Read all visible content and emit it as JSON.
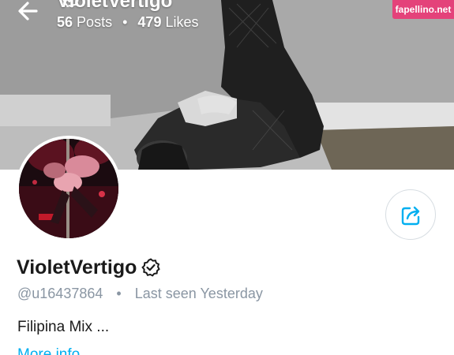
{
  "header": {
    "title": "VioletVertigo",
    "posts_count": "56",
    "posts_label": "Posts",
    "likes_count": "479",
    "likes_label": "Likes",
    "separator": "•"
  },
  "watermark": "fapellino.net",
  "profile": {
    "display_name": "VioletVertigo",
    "username": "@u16437864",
    "separator": "•",
    "last_seen": "Last seen Yesterday",
    "bio": "Filipina Mix ...",
    "more_info_label": "More info"
  },
  "colors": {
    "accent": "#00aff0",
    "muted_text": "#8a96a3",
    "watermark_bg": "#e4427a"
  },
  "icons": {
    "back": "arrow-left-icon",
    "more": "more-vertical-icon",
    "verified": "verified-badge-icon",
    "share": "share-icon"
  }
}
